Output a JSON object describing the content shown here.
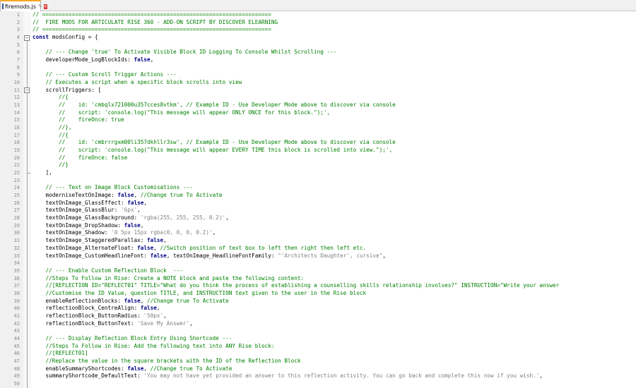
{
  "tab": {
    "filename": "firemods.js",
    "pin": "✎",
    "close": "✕"
  },
  "editor": {
    "lines": [
      {
        "n": "1",
        "s": [
          {
            "c": "comment",
            "t": "// ======================================================================"
          }
        ]
      },
      {
        "n": "2",
        "s": [
          {
            "c": "comment",
            "t": "//  FIRE MODS FOR ARTICULATE RISE 360 - ADD-ON SCRIPT BY DISCOVER ELEARNING"
          }
        ]
      },
      {
        "n": "3",
        "s": [
          {
            "c": "comment",
            "t": "// ======================================================================"
          }
        ]
      },
      {
        "n": "4",
        "s": [
          {
            "c": "kw",
            "t": "const"
          },
          {
            "c": "plain",
            "t": " modsConfig = {"
          }
        ]
      },
      {
        "n": "5",
        "s": []
      },
      {
        "n": "6",
        "s": [
          {
            "c": "comment",
            "t": "    // --- Change 'true' To Activate Visible Block ID Logging To Console Whilst Scrolling ---"
          }
        ]
      },
      {
        "n": "7",
        "s": [
          {
            "c": "plain",
            "t": "    developerMode_LogBlockIds: "
          },
          {
            "c": "kw",
            "t": "false"
          },
          {
            "c": "plain",
            "t": ","
          }
        ]
      },
      {
        "n": "8",
        "s": []
      },
      {
        "n": "9",
        "s": [
          {
            "c": "comment",
            "t": "    // --- Custom Scroll Trigger Actions ---"
          }
        ]
      },
      {
        "n": "10",
        "s": [
          {
            "c": "comment",
            "t": "    // Executes a script when a specific block scrolls into view"
          }
        ]
      },
      {
        "n": "11",
        "s": [
          {
            "c": "plain",
            "t": "    scrollTriggers: ["
          }
        ]
      },
      {
        "n": "12",
        "s": [
          {
            "c": "comment",
            "t": "        //{"
          }
        ]
      },
      {
        "n": "13",
        "s": [
          {
            "c": "comment",
            "t": "        //    id: 'cmbqlx721000u357cces8vtkm', // Example ID - Use Developer Mode above to discover via console"
          }
        ]
      },
      {
        "n": "14",
        "s": [
          {
            "c": "comment",
            "t": "        //    script: 'console.log(\"This message will appear ONLY ONCE for this block.\");',"
          }
        ]
      },
      {
        "n": "15",
        "s": [
          {
            "c": "comment",
            "t": "        //    fireOnce: true"
          }
        ]
      },
      {
        "n": "16",
        "s": [
          {
            "c": "comment",
            "t": "        //},"
          }
        ]
      },
      {
        "n": "17",
        "s": [
          {
            "c": "comment",
            "t": "        //{"
          }
        ]
      },
      {
        "n": "18",
        "s": [
          {
            "c": "comment",
            "t": "        //    id: 'cmbrrrgxm00li357dkhllr3sw', // Example ID - Use Developer Mode above to discover via console"
          }
        ]
      },
      {
        "n": "19",
        "s": [
          {
            "c": "comment",
            "t": "        //    script: 'console.log(\"This message will appear EVERY TIME this block is scrolled into view.\");',"
          }
        ]
      },
      {
        "n": "20",
        "s": [
          {
            "c": "comment",
            "t": "        //    fireOnce: false"
          }
        ]
      },
      {
        "n": "21",
        "s": [
          {
            "c": "comment",
            "t": "        //}"
          }
        ]
      },
      {
        "n": "22",
        "s": [
          {
            "c": "plain",
            "t": "    ],"
          }
        ]
      },
      {
        "n": "23",
        "s": []
      },
      {
        "n": "24",
        "s": [
          {
            "c": "comment",
            "t": "    // --- Text on Image Block Customisations ---"
          }
        ]
      },
      {
        "n": "25",
        "s": [
          {
            "c": "plain",
            "t": "    moderniseTextOnImage: "
          },
          {
            "c": "kw",
            "t": "false"
          },
          {
            "c": "plain",
            "t": ", "
          },
          {
            "c": "comment",
            "t": "//Change true To Activate"
          }
        ]
      },
      {
        "n": "26",
        "s": [
          {
            "c": "plain",
            "t": "    textOnImage_GlassEffect: "
          },
          {
            "c": "kw",
            "t": "false"
          },
          {
            "c": "plain",
            "t": ","
          }
        ]
      },
      {
        "n": "27",
        "s": [
          {
            "c": "plain",
            "t": "    textOnImage_GlassBlur: "
          },
          {
            "c": "str",
            "t": "'6px'"
          },
          {
            "c": "plain",
            "t": ","
          }
        ]
      },
      {
        "n": "28",
        "s": [
          {
            "c": "plain",
            "t": "    textOnImage_GlassBackground: "
          },
          {
            "c": "str",
            "t": "'rgba(255, 255, 255, 0.2)'"
          },
          {
            "c": "plain",
            "t": ","
          }
        ]
      },
      {
        "n": "29",
        "s": [
          {
            "c": "plain",
            "t": "    textOnImage_DropShadow: "
          },
          {
            "c": "kw",
            "t": "false"
          },
          {
            "c": "plain",
            "t": ","
          }
        ]
      },
      {
        "n": "30",
        "s": [
          {
            "c": "plain",
            "t": "    textOnImage_Shadow: "
          },
          {
            "c": "str",
            "t": "'0 5px 15px rgba(0, 0, 0, 0.2)'"
          },
          {
            "c": "plain",
            "t": ","
          }
        ]
      },
      {
        "n": "31",
        "s": [
          {
            "c": "plain",
            "t": "    textOnImage_StaggeredParallax: "
          },
          {
            "c": "kw",
            "t": "false"
          },
          {
            "c": "plain",
            "t": ","
          }
        ]
      },
      {
        "n": "32",
        "s": [
          {
            "c": "plain",
            "t": "    textOnImage_AlternateFloat: "
          },
          {
            "c": "kw",
            "t": "false"
          },
          {
            "c": "plain",
            "t": ", "
          },
          {
            "c": "comment",
            "t": "//Switch position of text box to left then right then left etc."
          }
        ]
      },
      {
        "n": "33",
        "s": [
          {
            "c": "plain",
            "t": "    textOnImage_CustomHeadlineFont: "
          },
          {
            "c": "kw",
            "t": "false"
          },
          {
            "c": "plain",
            "t": ", textOnImage_HeadlineFontFamily: "
          },
          {
            "c": "str",
            "t": "\"'Architects Daughter', cursive\""
          },
          {
            "c": "plain",
            "t": ","
          }
        ]
      },
      {
        "n": "34",
        "s": []
      },
      {
        "n": "35",
        "s": [
          {
            "c": "comment",
            "t": "    // --- Enable Custom Reflection Block  ---"
          }
        ]
      },
      {
        "n": "36",
        "s": [
          {
            "c": "comment",
            "t": "    //Steps To Follow in Rise: Create a NOTE block and paste the following content:"
          }
        ]
      },
      {
        "n": "37",
        "s": [
          {
            "c": "comment",
            "t": "    //[REFLECTION ID=\"REFLECT01\" TITLE=\"What do you think the process of establishing a counselling skills relationship involves?\" INSTRUCTION=\"Write your answer"
          }
        ]
      },
      {
        "n": "38",
        "s": [
          {
            "c": "comment",
            "t": "    //Customise the ID Value, question TITLE, and INSTRUCTION text given to the user in the Rise block"
          }
        ]
      },
      {
        "n": "39",
        "s": [
          {
            "c": "plain",
            "t": "    enableReflectionBlocks: "
          },
          {
            "c": "kw",
            "t": "false"
          },
          {
            "c": "plain",
            "t": ", "
          },
          {
            "c": "comment",
            "t": "//Change true To Activate"
          }
        ]
      },
      {
        "n": "40",
        "s": [
          {
            "c": "plain",
            "t": "    reflectionBlock_CentreAlign: "
          },
          {
            "c": "kw",
            "t": "false"
          },
          {
            "c": "plain",
            "t": ","
          }
        ]
      },
      {
        "n": "41",
        "s": [
          {
            "c": "plain",
            "t": "    reflectionBlock_ButtonRadius: "
          },
          {
            "c": "str",
            "t": "'50px'"
          },
          {
            "c": "plain",
            "t": ","
          }
        ]
      },
      {
        "n": "42",
        "s": [
          {
            "c": "plain",
            "t": "    reflectionBlock_ButtonText: "
          },
          {
            "c": "str",
            "t": "'Save My Answer'"
          },
          {
            "c": "plain",
            "t": ","
          }
        ]
      },
      {
        "n": "43",
        "s": []
      },
      {
        "n": "44",
        "s": [
          {
            "c": "comment",
            "t": "    // --- Display Reflection Block Entry Using Shortcode ---"
          }
        ]
      },
      {
        "n": "45",
        "s": [
          {
            "c": "comment",
            "t": "    //Steps To Follow in Rise: Add the following text into ANY Rise block:"
          }
        ]
      },
      {
        "n": "46",
        "s": [
          {
            "c": "comment",
            "t": "    //[REFLECT01]"
          }
        ]
      },
      {
        "n": "47",
        "s": [
          {
            "c": "comment",
            "t": "    //Replace the value in the square brackets with the ID of the Reflection Block"
          }
        ]
      },
      {
        "n": "48",
        "s": [
          {
            "c": "plain",
            "t": "    enableSummaryShortcodes: "
          },
          {
            "c": "kw",
            "t": "false"
          },
          {
            "c": "plain",
            "t": ", "
          },
          {
            "c": "comment",
            "t": "//Change true To Activate"
          }
        ]
      },
      {
        "n": "49",
        "s": [
          {
            "c": "plain",
            "t": "    summaryShortcode_DefaultText: "
          },
          {
            "c": "str",
            "t": "'You may not have yet provided an answer to this reflection activity. You can go back and complete this now if you wish.'"
          },
          {
            "c": "plain",
            "t": ","
          }
        ]
      },
      {
        "n": "50",
        "s": []
      }
    ]
  }
}
